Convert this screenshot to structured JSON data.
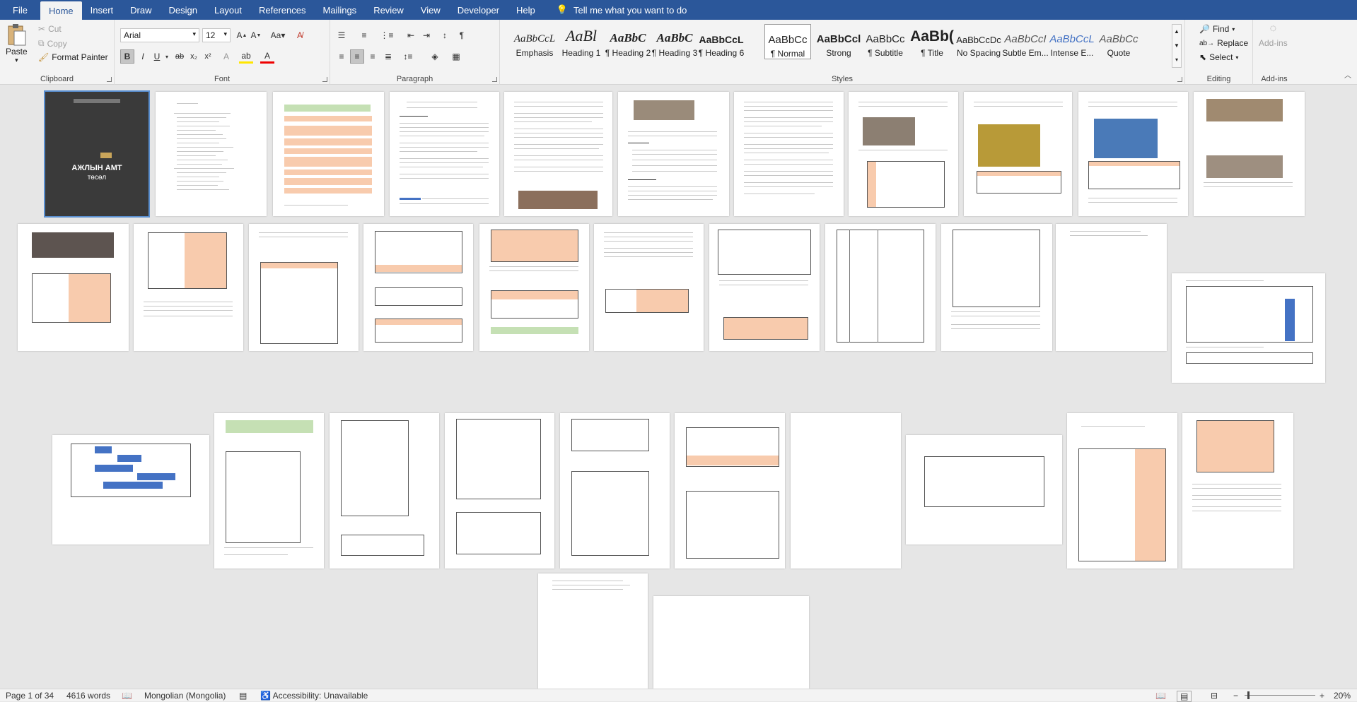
{
  "tabs": [
    "File",
    "Home",
    "Insert",
    "Draw",
    "Design",
    "Layout",
    "References",
    "Mailings",
    "Review",
    "View",
    "Developer",
    "Help"
  ],
  "tell_me": "Tell me what you want to do",
  "clipboard": {
    "paste": "Paste",
    "cut": "Cut",
    "copy": "Copy",
    "format_painter": "Format Painter",
    "label": "Clipboard"
  },
  "font": {
    "name": "Arial",
    "size": "12",
    "label": "Font"
  },
  "paragraph": {
    "label": "Paragraph"
  },
  "styles": {
    "label": "Styles",
    "items": [
      {
        "preview": "AaBbCcL",
        "name": "Emphasis"
      },
      {
        "preview": "AaBl",
        "name": "Heading 1"
      },
      {
        "preview": "AaBbC",
        "name": "¶ Heading 2"
      },
      {
        "preview": "AaBbC",
        "name": "¶ Heading 3"
      },
      {
        "preview": "AaBbCcL",
        "name": "¶ Heading 6"
      },
      {
        "preview": "AaBbCc",
        "name": "¶ Normal"
      },
      {
        "preview": "AaBbCcl",
        "name": "Strong"
      },
      {
        "preview": "AaBbCc",
        "name": "¶ Subtitle"
      },
      {
        "preview": "AaBb(",
        "name": "¶ Title"
      },
      {
        "preview": "AaBbCcDc",
        "name": "No Spacing"
      },
      {
        "preview": "AaBbCcI",
        "name": "Subtle Em..."
      },
      {
        "preview": "AaBbCcL",
        "name": "Intense E..."
      },
      {
        "preview": "AaBbCc",
        "name": "Quote"
      }
    ]
  },
  "editing": {
    "find": "Find",
    "replace": "Replace",
    "select": "Select",
    "label": "Editing"
  },
  "addins": {
    "button": "Add-ins",
    "label": "Add-ins"
  },
  "cover": {
    "title": "АЖЛЫН АМТ",
    "subtitle": "төсөл"
  },
  "status": {
    "page": "Page 1 of 34",
    "words": "4616 words",
    "language": "Mongolian (Mongolia)",
    "accessibility": "Accessibility: Unavailable",
    "zoom": "20%"
  }
}
